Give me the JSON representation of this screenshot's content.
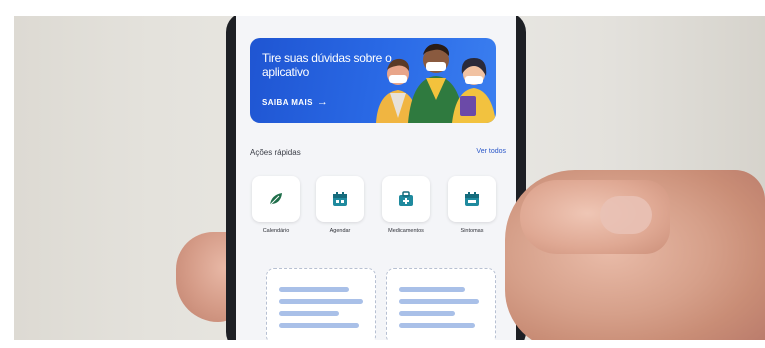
{
  "banner": {
    "title": "Tire suas dúvidas sobre o aplicativo",
    "cta": "SAIBA MAIS"
  },
  "quick_actions": {
    "title": "Ações rápidas",
    "see_all": "Ver todos",
    "items": [
      {
        "label": "Calendário",
        "icon": "leaf-icon"
      },
      {
        "label": "Agendar",
        "icon": "calendar-icon"
      },
      {
        "label": "Medicamentos",
        "icon": "medkit-icon"
      },
      {
        "label": "Sintomas",
        "icon": "calendar-icon"
      }
    ]
  },
  "colors": {
    "brand_blue": "#2a6ae6",
    "icon_teal": "#1f8a9e",
    "icon_green": "#1f6e4a"
  }
}
